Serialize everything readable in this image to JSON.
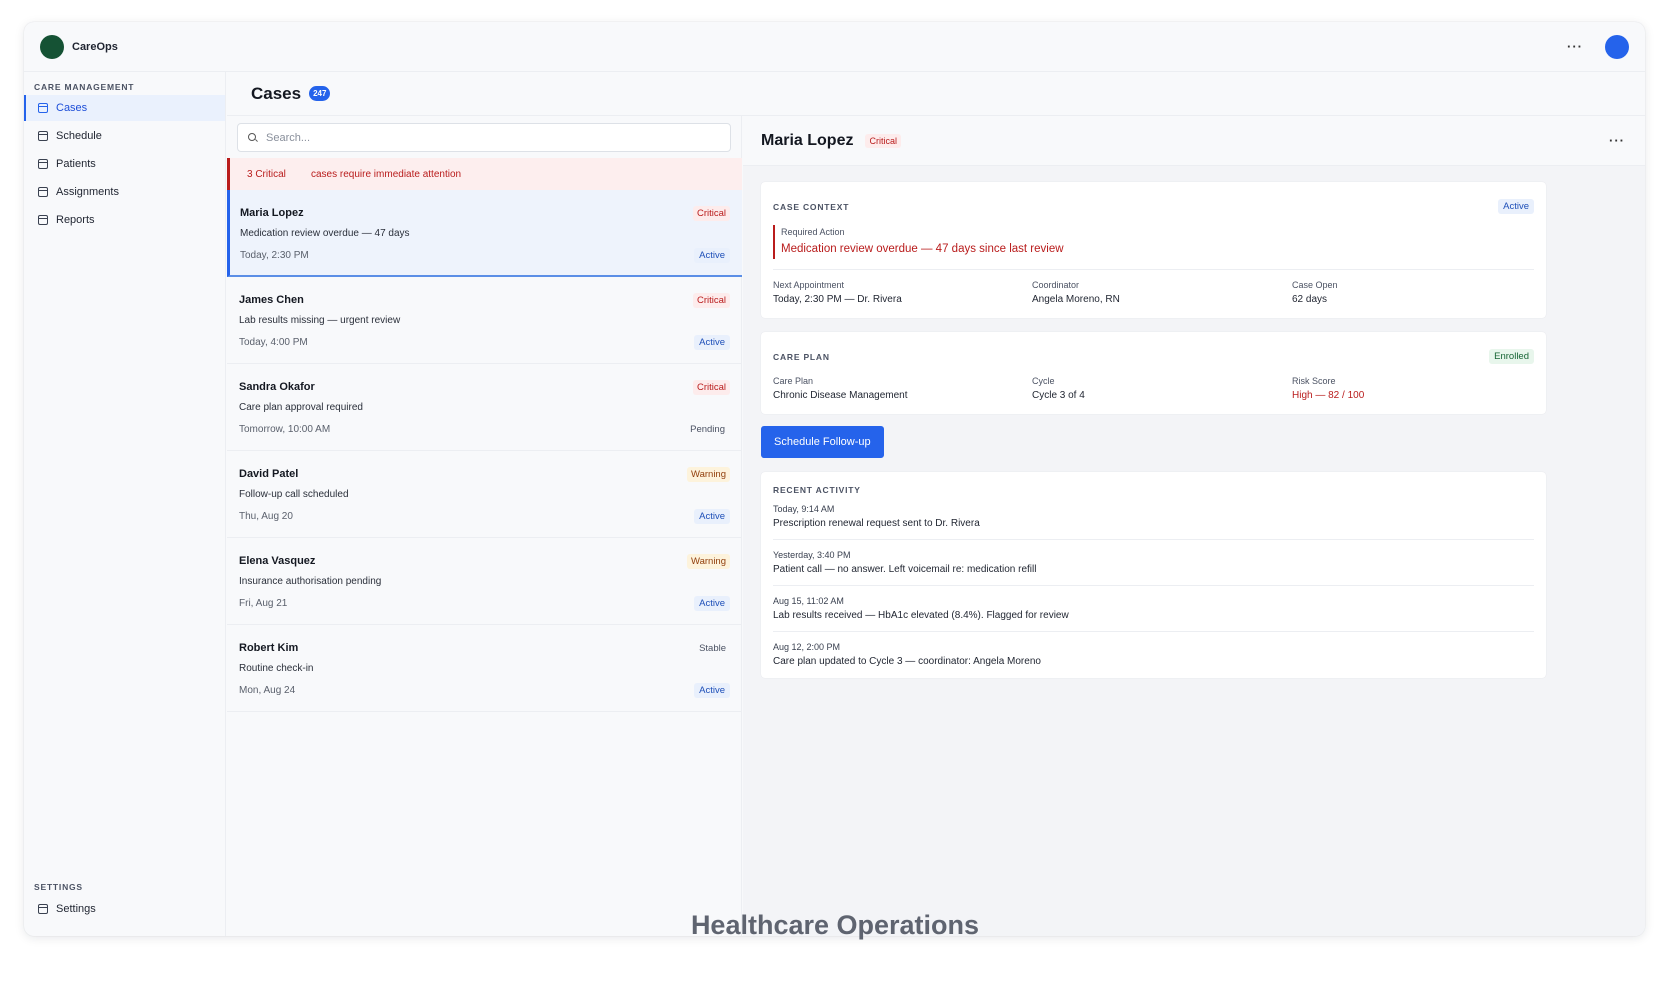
{
  "app": {
    "name": "CareOps"
  },
  "sidebar": {
    "section_main": "CARE MANAGEMENT",
    "items": [
      {
        "label": "Cases",
        "active": true
      },
      {
        "label": "Schedule"
      },
      {
        "label": "Patients"
      },
      {
        "label": "Assignments"
      },
      {
        "label": "Reports"
      }
    ],
    "section_settings": "SETTINGS",
    "settings_item": {
      "label": "Settings"
    }
  },
  "header": {
    "title": "Cases",
    "count": "247"
  },
  "search": {
    "placeholder": "Search..."
  },
  "alert": {
    "count": "3 Critical",
    "message": "cases require immediate attention"
  },
  "cases": [
    {
      "name": "Maria Lopez",
      "desc": "Medication review overdue — 47 days",
      "time": "Today, 2:30 PM",
      "severity": "Critical",
      "status": "Active"
    },
    {
      "name": "James Chen",
      "desc": "Lab results missing — urgent review",
      "time": "Today, 4:00 PM",
      "severity": "Critical",
      "status": "Active"
    },
    {
      "name": "Sandra Okafor",
      "desc": "Care plan approval required",
      "time": "Tomorrow, 10:00 AM",
      "severity": "Critical",
      "status": "Pending"
    },
    {
      "name": "David Patel",
      "desc": "Follow-up call scheduled",
      "time": "Thu, Aug 20",
      "severity": "Warning",
      "status": "Active"
    },
    {
      "name": "Elena Vasquez",
      "desc": "Insurance authorisation pending",
      "time": "Fri, Aug 21",
      "severity": "Warning",
      "status": "Active"
    },
    {
      "name": "Robert Kim",
      "desc": "Routine check-in",
      "time": "Mon, Aug 24",
      "severity": "Stable",
      "status": "Active"
    }
  ],
  "detail": {
    "name": "Maria Lopez",
    "severity": "Critical",
    "case_context": {
      "label": "CASE CONTEXT",
      "tag": "Active",
      "required_label": "Required Action",
      "required_value": "Medication review overdue — 47 days since last review",
      "fields": [
        {
          "label": "Next Appointment",
          "value": "Today, 2:30 PM — Dr. Rivera"
        },
        {
          "label": "Coordinator",
          "value": "Angela Moreno, RN"
        },
        {
          "label": "Case Open",
          "value": "62 days"
        }
      ]
    },
    "care_plan": {
      "label": "CARE PLAN",
      "tag": "Enrolled",
      "fields": [
        {
          "label": "Care Plan",
          "value": "Chronic Disease Management"
        },
        {
          "label": "Cycle",
          "value": "Cycle 3 of 4"
        },
        {
          "label": "Risk Score",
          "value": "High — 82 / 100"
        }
      ]
    },
    "action_button": "Schedule Follow-up",
    "recent_activity": {
      "label": "RECENT ACTIVITY",
      "items": [
        {
          "time": "Today, 9:14 AM",
          "text": "Prescription renewal request sent to Dr. Rivera"
        },
        {
          "time": "Yesterday, 3:40 PM",
          "text": "Patient call — no answer. Left voicemail re: medication refill"
        },
        {
          "time": "Aug 15, 11:02 AM",
          "text": "Lab results received — HbA1c elevated (8.4%). Flagged for review"
        },
        {
          "time": "Aug 12, 2:00 PM",
          "text": "Care plan updated to Cycle 3 — coordinator: Angela Moreno"
        }
      ]
    }
  },
  "caption": "Healthcare Operations",
  "colors": {
    "accent": "#2563eb",
    "critical": "#b91c1c",
    "brand": "#155234"
  }
}
